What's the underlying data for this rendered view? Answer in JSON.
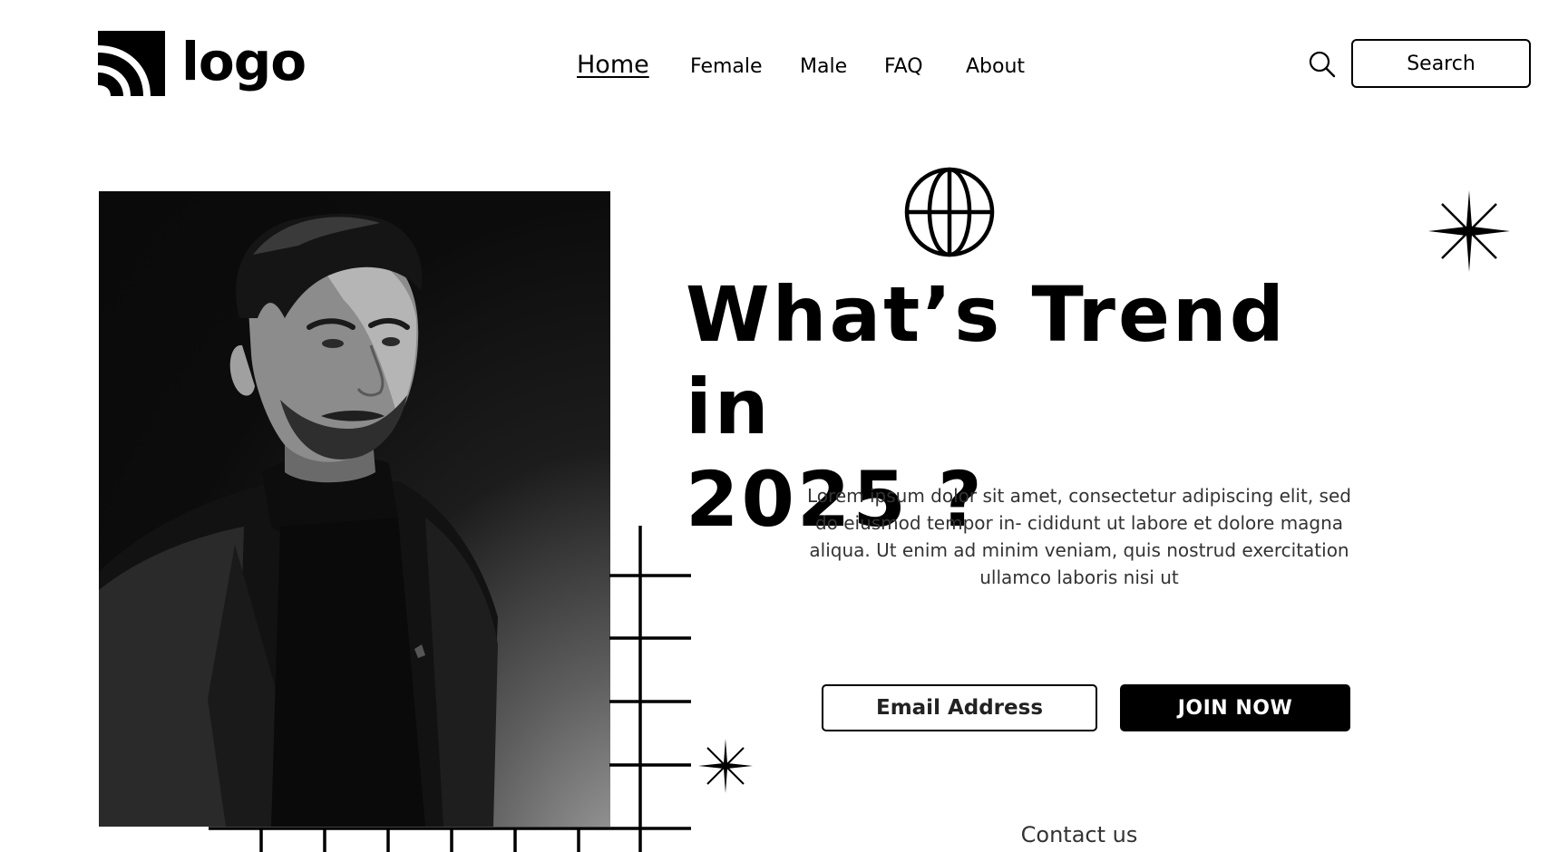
{
  "brand": {
    "logo_text": "logo"
  },
  "nav": {
    "items": [
      {
        "label": "Home",
        "active": true
      },
      {
        "label": "Female",
        "active": false
      },
      {
        "label": "Male",
        "active": false
      },
      {
        "label": "FAQ",
        "active": false
      },
      {
        "label": "About",
        "active": false
      }
    ]
  },
  "search": {
    "label": "Search",
    "icon": "search-icon"
  },
  "hero": {
    "title_line1": "What’s Trend in",
    "title_line2": "2025 ?",
    "description": "Lorem ipsum dolor sit amet, consectetur adipiscing elit, sed do eiusmod tempor in- cididunt ut labore et dolore magna aliqua. Ut enim ad minim veniam, quis nostrud exercitation ullamco laboris nisi ut",
    "photo_icon": "portrait-photo",
    "decor_icons": [
      "globe-icon",
      "sparkle-star-icon",
      "grid-lines"
    ]
  },
  "signup": {
    "email_placeholder": "Email Address",
    "join_label": "JOIN NOW"
  },
  "footer": {
    "contact_label": "Contact us"
  },
  "colors": {
    "primary": "#000000",
    "background": "#ffffff",
    "text_muted": "#333333"
  }
}
